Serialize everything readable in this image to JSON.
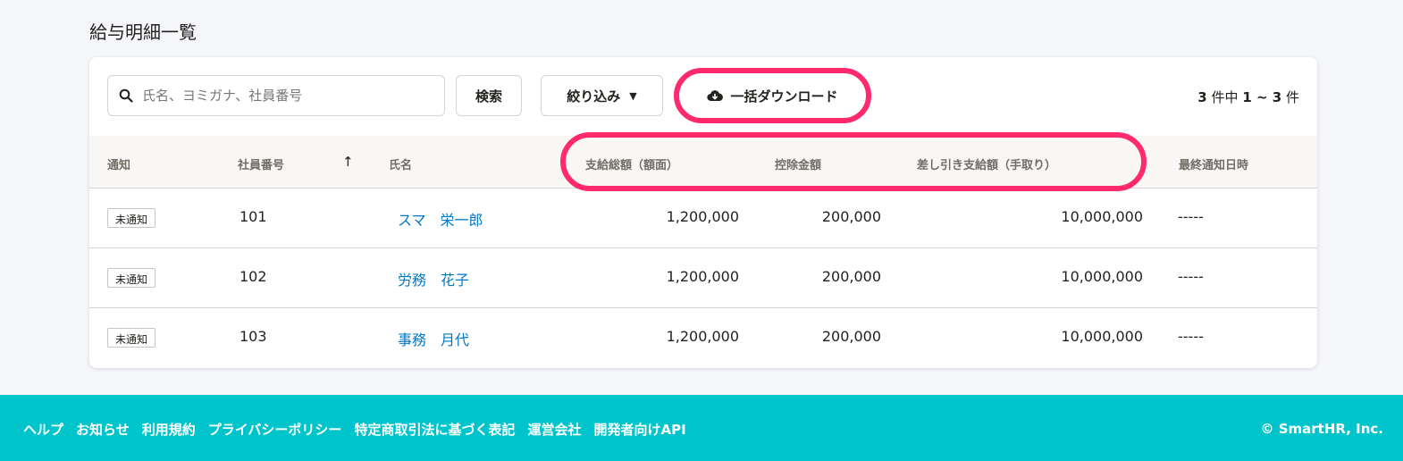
{
  "page": {
    "title": "給与明細一覧"
  },
  "toolbar": {
    "search_placeholder": "氏名、ヨミガナ、社員番号",
    "search_button": "検索",
    "filter_button": "絞り込み",
    "download_button": "一括ダウンロード",
    "count": {
      "prefix": "3",
      "mid": "件中",
      "range": "1 ~ 3",
      "suffix": "件"
    }
  },
  "table": {
    "headers": {
      "notify": "通知",
      "employee_no": "社員番号",
      "name": "氏名",
      "gross": "支給総額（額面）",
      "deduction": "控除金額",
      "net": "差し引き支給額（手取り）",
      "last_notified": "最終通知日時"
    },
    "rows": [
      {
        "status": "未通知",
        "employee_no": "101",
        "name": "スマ　栄一郎",
        "gross": "1,200,000",
        "deduction": "200,000",
        "net": "10,000,000",
        "last_notified": "-----"
      },
      {
        "status": "未通知",
        "employee_no": "102",
        "name": "労務　花子",
        "gross": "1,200,000",
        "deduction": "200,000",
        "net": "10,000,000",
        "last_notified": "-----"
      },
      {
        "status": "未通知",
        "employee_no": "103",
        "name": "事務　月代",
        "gross": "1,200,000",
        "deduction": "200,000",
        "net": "10,000,000",
        "last_notified": "-----"
      }
    ]
  },
  "footer": {
    "links": [
      "ヘルプ",
      "お知らせ",
      "利用規約",
      "プライバシーポリシー",
      "特定商取引法に基づく表記",
      "運営会社",
      "開発者向けAPI"
    ],
    "copyright": "© SmartHR, Inc."
  },
  "colors": {
    "highlight": "#ff2a6d",
    "footer": "#00c4cc",
    "link": "#0077c7"
  },
  "icons": {
    "search": "search-icon",
    "sort": "arrow-up-icon",
    "download": "cloud-download-icon",
    "filter": "caret-down-icon"
  }
}
